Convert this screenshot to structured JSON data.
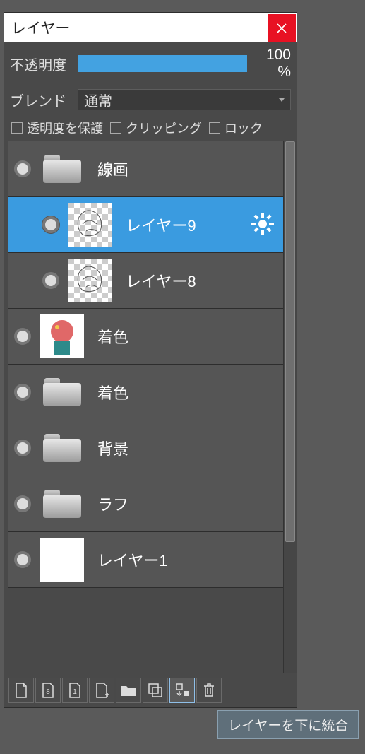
{
  "panel": {
    "title": "レイヤー"
  },
  "opacity": {
    "label": "不透明度",
    "value": "100 %"
  },
  "blend": {
    "label": "ブレンド",
    "mode": "通常"
  },
  "options": {
    "protect_opacity": "透明度を保護",
    "clipping": "クリッピング",
    "lock": "ロック"
  },
  "layers": [
    {
      "name": "線画",
      "type": "folder",
      "indent": 0,
      "selected": false
    },
    {
      "name": "レイヤー9",
      "type": "sketch",
      "indent": 1,
      "selected": true,
      "gear": true
    },
    {
      "name": "レイヤー8",
      "type": "sketch",
      "indent": 1,
      "selected": false
    },
    {
      "name": "着色",
      "type": "color",
      "indent": 0,
      "selected": false
    },
    {
      "name": "着色",
      "type": "folder",
      "indent": 0,
      "selected": false
    },
    {
      "name": "背景",
      "type": "folder",
      "indent": 0,
      "selected": false
    },
    {
      "name": "ラフ",
      "type": "folder",
      "indent": 0,
      "selected": false
    },
    {
      "name": "レイヤー1",
      "type": "white",
      "indent": 0,
      "selected": false
    }
  ],
  "tooltip": "レイヤーを下に統合"
}
